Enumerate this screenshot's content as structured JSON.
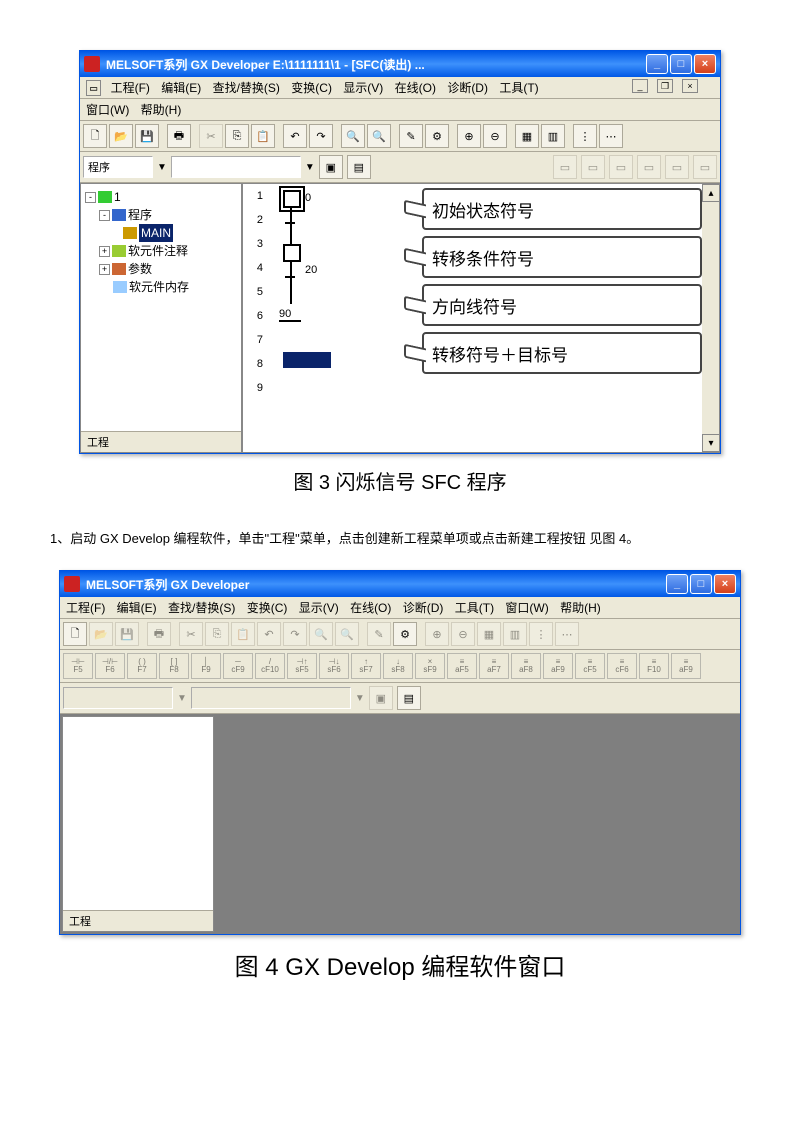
{
  "fig1": {
    "title": "MELSOFT系列 GX Developer E:\\1111111\\1 - [SFC(读出) ...",
    "menu": [
      "工程(F)",
      "编辑(E)",
      "查找/替换(S)",
      "变换(C)",
      "显示(V)",
      "在线(O)",
      "诊断(D)",
      "工具(T)"
    ],
    "menu2": [
      "窗口(W)",
      "帮助(H)"
    ],
    "prog_label": "程序",
    "tree": {
      "root": "1",
      "items": [
        "程序",
        "MAIN",
        "软元件注释",
        "参数",
        "软元件内存"
      ]
    },
    "tab": "工程",
    "rows": [
      "1",
      "2",
      "3",
      "4",
      "5",
      "6",
      "7",
      "8",
      "9"
    ],
    "marks": {
      "r1": "0",
      "r4": "20",
      "r6": "90"
    },
    "callouts": [
      "初始状态符号",
      "转移条件符号",
      "方向线符号",
      "转移符号＋目标号"
    ]
  },
  "cap1": "图 3 闪烁信号 SFC 程序",
  "instr": "1、启动 GX  Develop 编程软件，单击\"工程\"菜单，点击创建新工程菜单项或点击新建工程按钮  见图 4。",
  "fig2": {
    "title": "MELSOFT系列 GX Developer",
    "menu": [
      "工程(F)",
      "编辑(E)",
      "查找/替换(S)",
      "变换(C)",
      "显示(V)",
      "在线(O)",
      "诊断(D)",
      "工具(T)",
      "窗口(W)",
      "帮助(H)"
    ],
    "tab": "工程",
    "fkeys": [
      "F5",
      "F6",
      "F7",
      "F8",
      "F9",
      "cF9",
      "cF10",
      "sF5",
      "sF6",
      "sF7",
      "sF8",
      "sF9",
      "aF5",
      "aF7",
      "aF8",
      "aF9",
      "cF5",
      "cF6",
      "F10",
      "aF9"
    ]
  },
  "cap2": "图 4 GX Develop 编程软件窗口"
}
